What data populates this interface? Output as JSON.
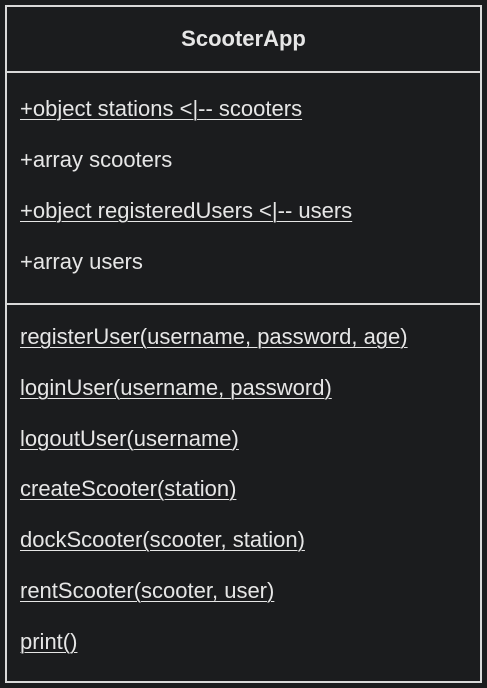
{
  "class_name": "ScooterApp",
  "attributes": [
    {
      "text": "+object stations <|-- scooters",
      "static": true
    },
    {
      "text": "+array scooters",
      "static": false
    },
    {
      "text": "+object registeredUsers <|-- users",
      "static": true
    },
    {
      "text": "+array users",
      "static": false
    }
  ],
  "methods": [
    {
      "text": "registerUser(username, password, age)",
      "static": true
    },
    {
      "text": "loginUser(username, password)",
      "static": true
    },
    {
      "text": "logoutUser(username)",
      "static": true
    },
    {
      "text": "createScooter(station)",
      "static": true
    },
    {
      "text": "dockScooter(scooter, station)",
      "static": true
    },
    {
      "text": "rentScooter(scooter, user)",
      "static": true
    },
    {
      "text": "print()",
      "static": true
    }
  ],
  "colors": {
    "background": "#1b1c1e",
    "border": "#d9d9d9",
    "text": "#e6e6e6"
  }
}
